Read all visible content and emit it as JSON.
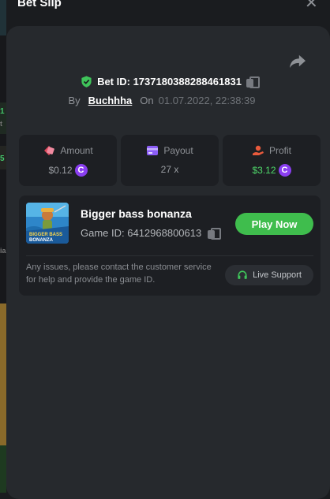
{
  "window": {
    "title": "Bet Slip",
    "close_icon": "close-icon"
  },
  "bet": {
    "id_label": "Bet ID: 173718038828846183​1",
    "by_label": "By",
    "user": "Buchhha",
    "on_label": "On",
    "date": "01.07.2022, 22:38:39"
  },
  "stats": {
    "amount": {
      "label": "Amount",
      "value": "$0.12",
      "coin": "C"
    },
    "payout": {
      "label": "Payout",
      "value": "27 x"
    },
    "profit": {
      "label": "Profit",
      "value": "$3.12",
      "coin": "C"
    }
  },
  "game": {
    "title": "Bigger bass bonanza",
    "id_label": "Game ID: 6412968800613",
    "thumb_text": "BIGGER BASS BONANZA",
    "play_label": "Play Now",
    "help_text": "Any issues, please contact the customer service for help and provide the game ID.",
    "support_label": "Live Support"
  },
  "colors": {
    "accent_green": "#3fbd4d",
    "profit_green": "#4fd86a",
    "coin_purple": "#8a3ef0",
    "panel": "#26292d",
    "card": "#1d1f23"
  },
  "background_fragments": [
    "1",
    "t",
    "5",
    "ial"
  ]
}
